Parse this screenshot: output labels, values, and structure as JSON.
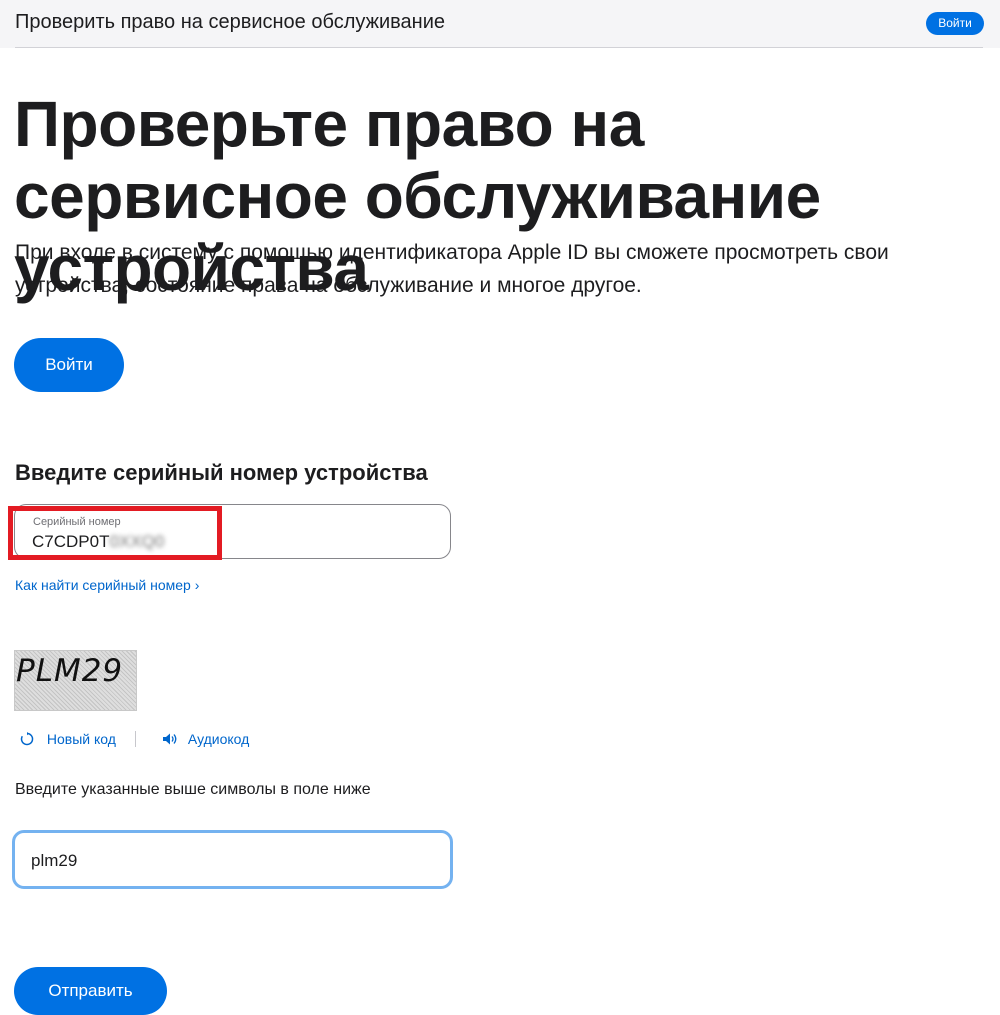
{
  "topbar": {
    "title": "Проверить право на сервисное обслуживание",
    "signin_label": "Войти"
  },
  "hero": {
    "headline": "Проверьте право на сервисное обслуживание устройства",
    "intro": "При входе в систему с помощью идентификатора Apple ID вы сможете просмотреть свои устройства, состояние права на обслуживание и многое другое.",
    "signin_label": "Войти"
  },
  "serial": {
    "heading": "Введите серийный номер устройства",
    "field_label": "Серийный номер",
    "value_visible": "C7CDP0T",
    "value_blurred": "0XXQ0",
    "find_link": "Как найти серийный номер ›",
    "highlight_color": "#e31b23"
  },
  "captcha": {
    "image_text": "PLM29",
    "new_code_label": "Новый код",
    "new_code_icon": "refresh-icon",
    "audio_label": "Аудиокод",
    "audio_icon": "speaker-icon",
    "instruction": "Введите указанные выше символы в поле ниже",
    "input_value": "plm29"
  },
  "submit_label": "Отправить",
  "colors": {
    "accent": "#0071e3",
    "link": "#0066cc",
    "focus": "#74b2f0"
  }
}
